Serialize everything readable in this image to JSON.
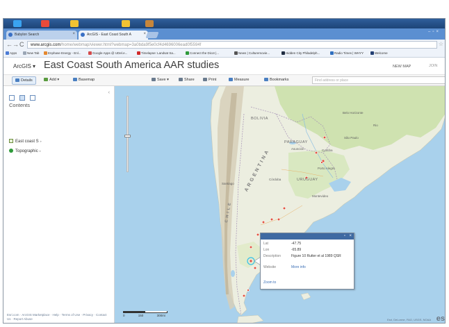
{
  "browser": {
    "tabs": [
      {
        "label": "Babylon Search"
      },
      {
        "label": "ArcGIS - East Coast South A"
      }
    ],
    "url_host": "www.arcgis.com",
    "url_path": "/home/webmap/viewer.html?webmap=3a0bda9f5e0cf4d4696006ead0f5594f",
    "bookmarks": [
      {
        "label": "Apps",
        "color": "#4b7bd5"
      },
      {
        "label": "New Tab",
        "color": "#9aa6b5"
      },
      {
        "label": "Enphase Energy - Enl...",
        "color": "#e4882f"
      },
      {
        "label": "Google Apps @ UDel.e...",
        "color": "#d44b4b"
      },
      {
        "label": "Timelapse: Landsat Sa...",
        "color": "#d02a2a"
      },
      {
        "label": "Connect the Dicot |...",
        "color": "#2e9a3a"
      },
      {
        "label": "News | Culturemovie...",
        "color": "#555555"
      },
      {
        "label": "Hidden City Philadelph...",
        "color": "#1f2c40"
      },
      {
        "label": "Radio Times | WHYY",
        "color": "#2f6fbf"
      },
      {
        "label": "Welcome",
        "color": "#233f73"
      }
    ]
  },
  "arcgis": {
    "logo": "ArcGIS",
    "title": "East Coast South America AAR studies",
    "new_map": "NEW MAP",
    "join": "JOIN",
    "toolbar": {
      "details": "Details",
      "add": "Add",
      "basemap": "Basemap",
      "save": "Save",
      "share": "Share",
      "print": "Print",
      "measure": "Measure",
      "bookmarks": "Bookmarks",
      "search_placeholder": "Find address or place"
    },
    "contents_label": "Contents",
    "layers": [
      {
        "label": "East coast S",
        "type": "checkbox"
      },
      {
        "label": "Topographic",
        "type": "basemap"
      }
    ],
    "footer": "Esri.com · ArcGIS Marketplace · Help · Terms of Use · Privacy · Contact Us · Report Abuse"
  },
  "map": {
    "labels": {
      "bolivia": "BOLIVIA",
      "paraguay": "PARAGUAY",
      "uruguay": "URUGUAY",
      "argentina": "ARGENTINA",
      "chile": "CHILE",
      "asuncion": "Asunción",
      "cordoba": "Córdoba",
      "santiago": "Santiago",
      "montevideo": "Montevideo",
      "sao_paulo": "São Paulo",
      "curitiba": "Curitiba",
      "porto_alegre": "Porto Alegre",
      "rio": "Rio",
      "belo": "Belo Horizonte"
    },
    "scale_labels": [
      "0",
      "150",
      "300mi"
    ],
    "attribution": "Esri, DeLorme, FAO, USGS, NOAA",
    "esri_logo": "es"
  },
  "popup": {
    "lat_label": "Lat",
    "lat_value": "-47.75",
    "lon_label": "Lon",
    "lon_value": "-65.89",
    "desc_label": "Description",
    "desc_value": "Figure 10 Rutter et al 1989 QSR",
    "website_label": "Website",
    "website_value": "More info",
    "zoom_to": "Zoom to"
  }
}
